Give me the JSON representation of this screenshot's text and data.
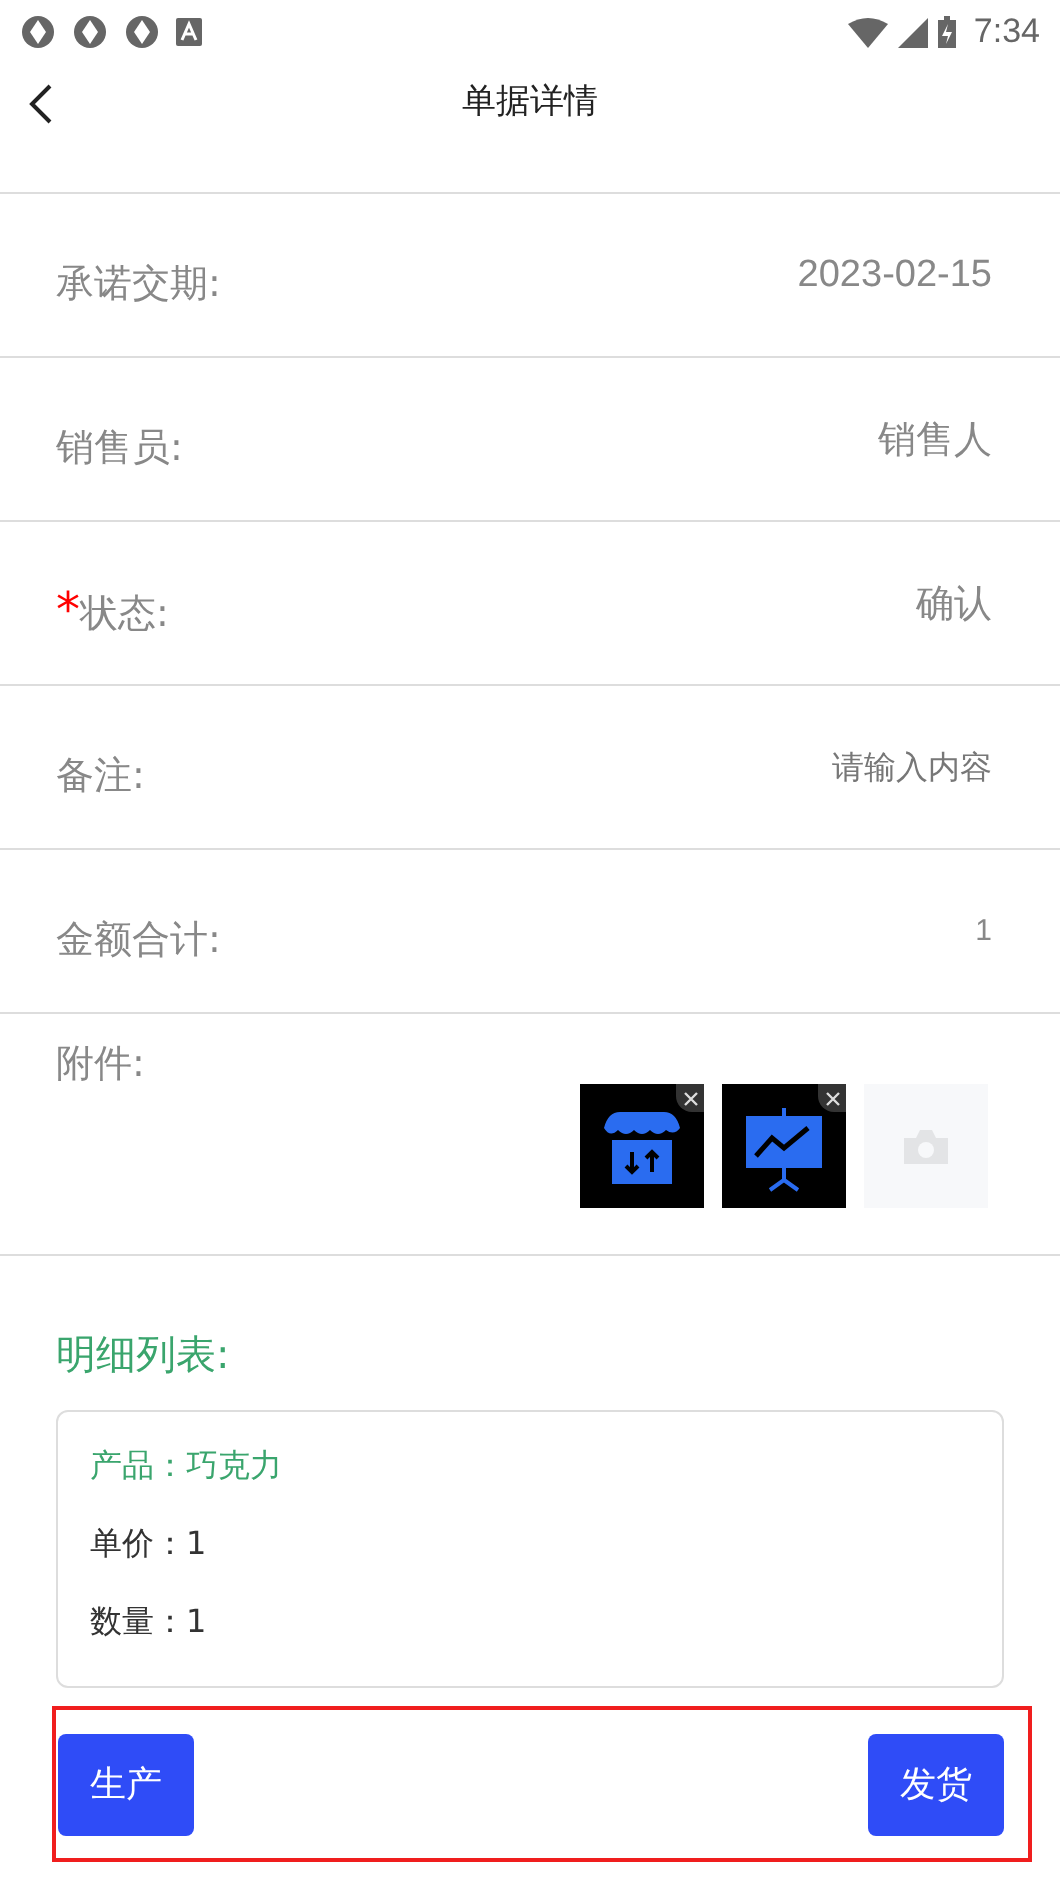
{
  "status_bar": {
    "time": "7:34"
  },
  "header": {
    "title": "单据详情"
  },
  "required_symbol": "*",
  "fields": [
    {
      "label": "承诺交期:",
      "value": "2023-02-15",
      "required": false,
      "kind": "value"
    },
    {
      "label": "销售员:",
      "value": "销售人",
      "required": false,
      "kind": "value"
    },
    {
      "label": "状态:",
      "value": "确认",
      "required": true,
      "kind": "value"
    },
    {
      "label": "备注:",
      "placeholder": "请输入内容",
      "required": false,
      "kind": "input"
    },
    {
      "label": "金额合计:",
      "value": "1",
      "required": false,
      "kind": "small"
    }
  ],
  "attachments": {
    "label": "附件:",
    "items": [
      {
        "kind": "store"
      },
      {
        "kind": "chart"
      }
    ],
    "add": true
  },
  "detail": {
    "title": "明细列表:",
    "items": [
      {
        "product": "产品：巧克力",
        "price": "单价：1",
        "qty": "数量：1"
      }
    ]
  },
  "actions": {
    "highlighted": true,
    "buttons": [
      "生产",
      "发货"
    ]
  }
}
